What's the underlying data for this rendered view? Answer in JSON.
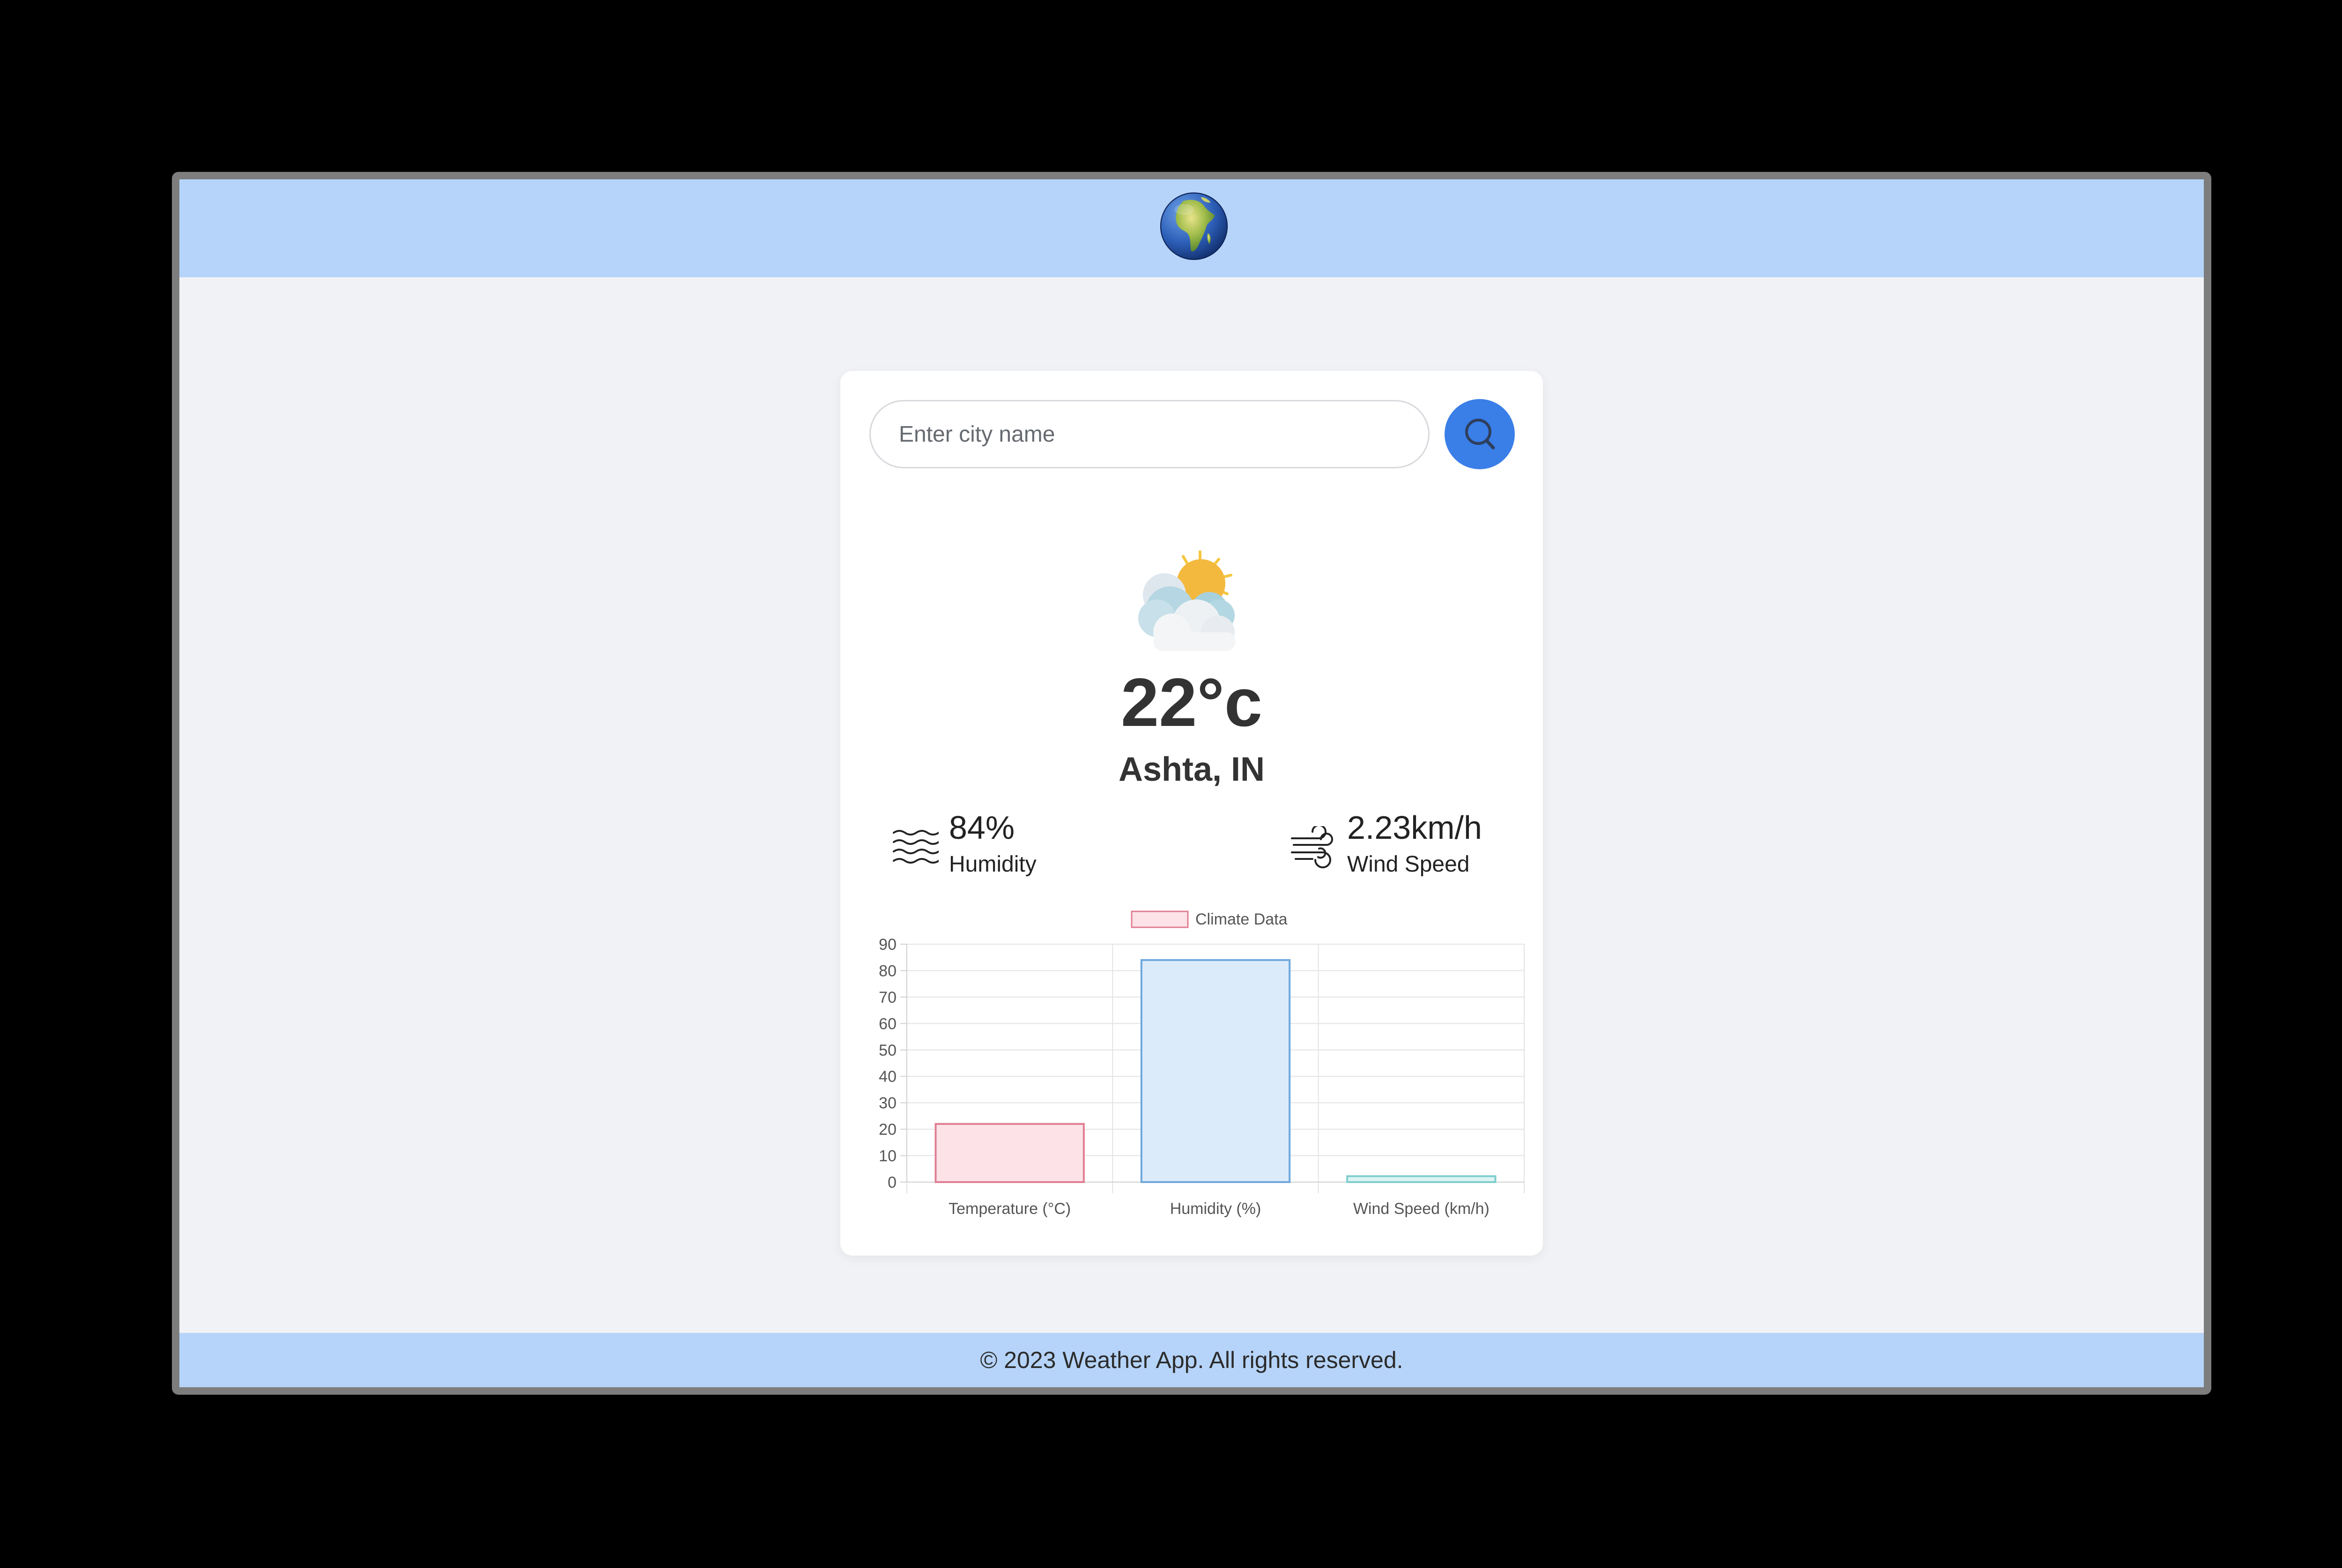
{
  "header": {
    "logo_icon": "globe-africa-icon"
  },
  "search": {
    "placeholder": "Enter city name",
    "value": "",
    "button_icon": "search-icon",
    "button_color": "#3a7ee8"
  },
  "weather": {
    "icon": "sun-behind-clouds-icon",
    "temperature": "22°c",
    "location": "Ashta, IN",
    "humidity_value": "84%",
    "humidity_label": "Humidity",
    "humidity_icon": "humidity-waves-icon",
    "wind_value": "2.23km/h",
    "wind_label": "Wind Speed",
    "wind_icon": "wind-icon"
  },
  "chart_data": {
    "type": "bar",
    "categories": [
      "Temperature (°C)",
      "Humidity (%)",
      "Wind Speed (km/h)"
    ],
    "series": [
      {
        "name": "Climate Data",
        "values": [
          22,
          84,
          2.23
        ],
        "fill_colors": [
          "#fde3e8",
          "#dcebfa",
          "#def4f4"
        ],
        "border_colors": [
          "#e07d92",
          "#6fa7dc",
          "#7fcdcd"
        ]
      }
    ],
    "ylim": [
      0,
      90
    ],
    "yticks": [
      0,
      10,
      20,
      30,
      40,
      50,
      60,
      70,
      80,
      90
    ],
    "legend": "top-center",
    "legend_fill": "#fde3e8",
    "legend_border": "#e07d92",
    "grid": true,
    "title": "",
    "xlabel": "",
    "ylabel": ""
  },
  "footer": {
    "text": "© 2023 Weather App. All rights reserved."
  },
  "colors": {
    "header_bg": "#b6d4f9",
    "page_bg": "#f0f2f5",
    "card_bg": "#ffffff",
    "text": "#333333"
  }
}
